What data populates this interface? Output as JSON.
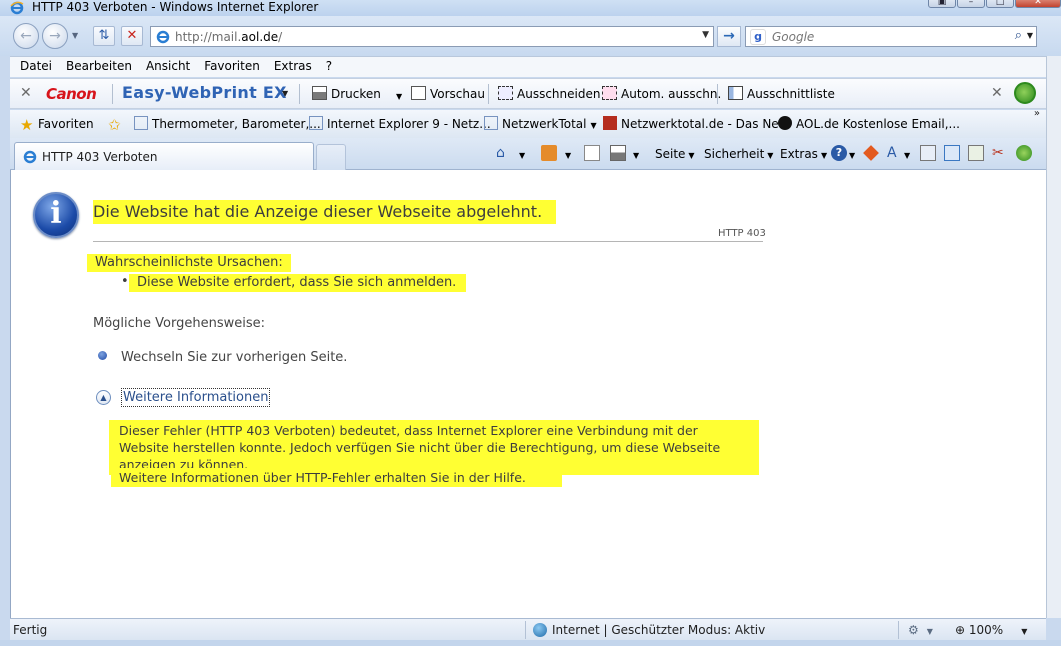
{
  "window": {
    "title": "HTTP 403 Verboten - Windows Internet Explorer",
    "controls": [
      "▣",
      "–",
      "□",
      "✕"
    ]
  },
  "address": {
    "url_prefix": "http://mail.",
    "url_domain": "aol.de",
    "url_suffix": "/",
    "search_placeholder": "Google"
  },
  "menu": [
    "Datei",
    "Bearbeiten",
    "Ansicht",
    "Favoriten",
    "Extras",
    "?"
  ],
  "canon_toolbar": {
    "logo": "Canon",
    "product": "Easy-WebPrint EX",
    "buttons": [
      "Drucken",
      "Vorschau",
      "Ausschneiden",
      "Autom. ausschn.",
      "Ausschnittliste"
    ]
  },
  "favorites": {
    "label": "Favoriten",
    "items": [
      "Thermometer, Barometer,...",
      "Internet Explorer 9 - Netz...",
      "NetzwerkTotal",
      "Netzwerktotal.de - Das Ne...",
      "AOL.de  Kostenlose Email,..."
    ]
  },
  "tab": {
    "label": "HTTP 403 Verboten"
  },
  "commandbar": [
    "Seite",
    "Sicherheit",
    "Extras"
  ],
  "page": {
    "headline": "Die Website hat die Anzeige dieser Webseite abgelehnt.",
    "code": "HTTP 403",
    "causes_heading": "Wahrscheinlichste Ursachen:",
    "cause": "Diese Website erfordert, dass Sie sich anmelden.",
    "options_heading": "Mögliche Vorgehensweise:",
    "go_back": "Wechseln Sie zur vorherigen Seite.",
    "more_info": "Weitere Informationen",
    "detail": "Dieser Fehler (HTTP 403 Verboten) bedeutet, dass Internet Explorer eine Verbindung mit der Website herstellen konnte. Jedoch verfügen Sie nicht über die Berechtigung, um diese Webseite anzeigen zu können.",
    "help": "Weitere Informationen über HTTP-Fehler erhalten Sie in der Hilfe."
  },
  "status": {
    "left": "Fertig",
    "zone": "Internet | Geschützter Modus: Aktiv",
    "zoom": "100%"
  },
  "colors": {
    "highlight": "#ffff33",
    "link": "#2a4f8c",
    "canon_red": "#d7141b",
    "ewp_blue": "#2f63b4"
  }
}
